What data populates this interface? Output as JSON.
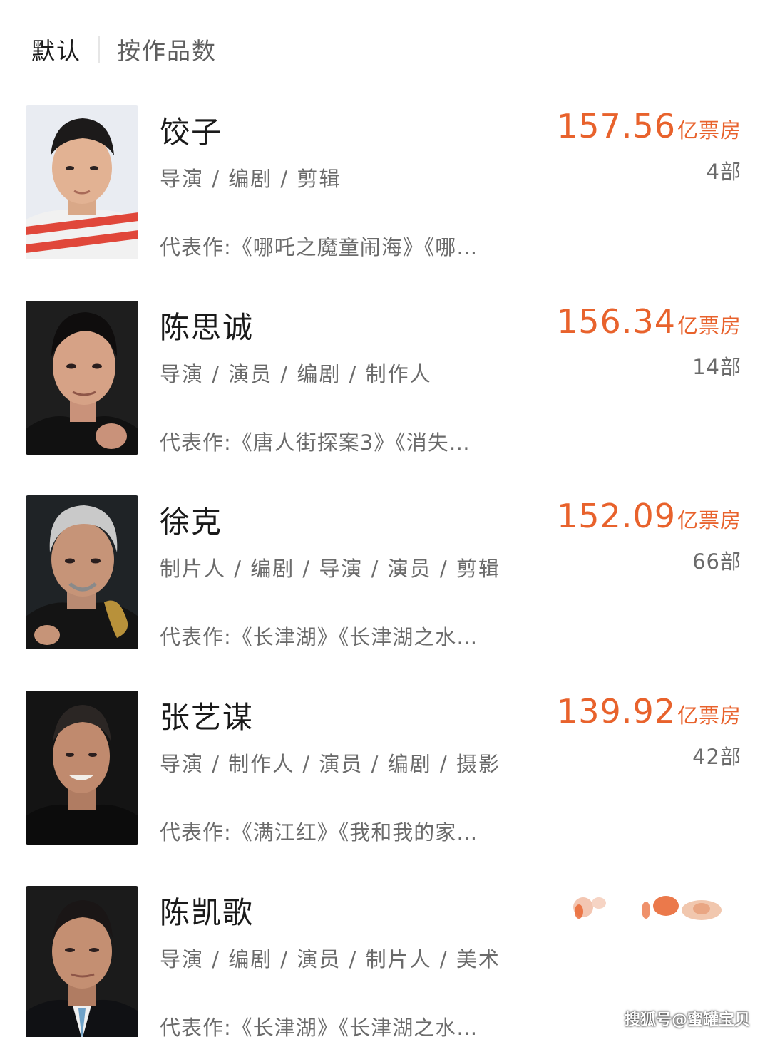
{
  "sort": {
    "default_label": "默认",
    "by_works_label": "按作品数"
  },
  "people": [
    {
      "name": "饺子",
      "roles": "导演 / 编剧 / 剪辑",
      "works": "代表作:《哪吒之魔童闹海》《哪…",
      "box_value": "157.56",
      "box_unit": "亿票房",
      "count": "4部"
    },
    {
      "name": "陈思诚",
      "roles": "导演 / 演员 / 编剧 / 制作人",
      "works": "代表作:《唐人街探案3》《消失…",
      "box_value": "156.34",
      "box_unit": "亿票房",
      "count": "14部"
    },
    {
      "name": "徐克",
      "roles": "制片人 / 编剧 / 导演 / 演员 / 剪辑",
      "works": "代表作:《长津湖》《长津湖之水…",
      "box_value": "152.09",
      "box_unit": "亿票房",
      "count": "66部"
    },
    {
      "name": "张艺谋",
      "roles": "导演 / 制作人 / 演员 / 编剧 / 摄影",
      "works": "代表作:《满江红》《我和我的家…",
      "box_value": "139.92",
      "box_unit": "亿票房",
      "count": "42部"
    },
    {
      "name": "陈凯歌",
      "roles": "导演 / 编剧 / 演员 / 制片人 / 美术",
      "works": "代表作:《长津湖》《长津湖之水…"
    }
  ],
  "watermark": "搜狐号@蜜罐宝贝",
  "colors": {
    "accent": "#e8622c",
    "text_primary": "#1a1a1a",
    "text_secondary": "#6b6b6b"
  }
}
